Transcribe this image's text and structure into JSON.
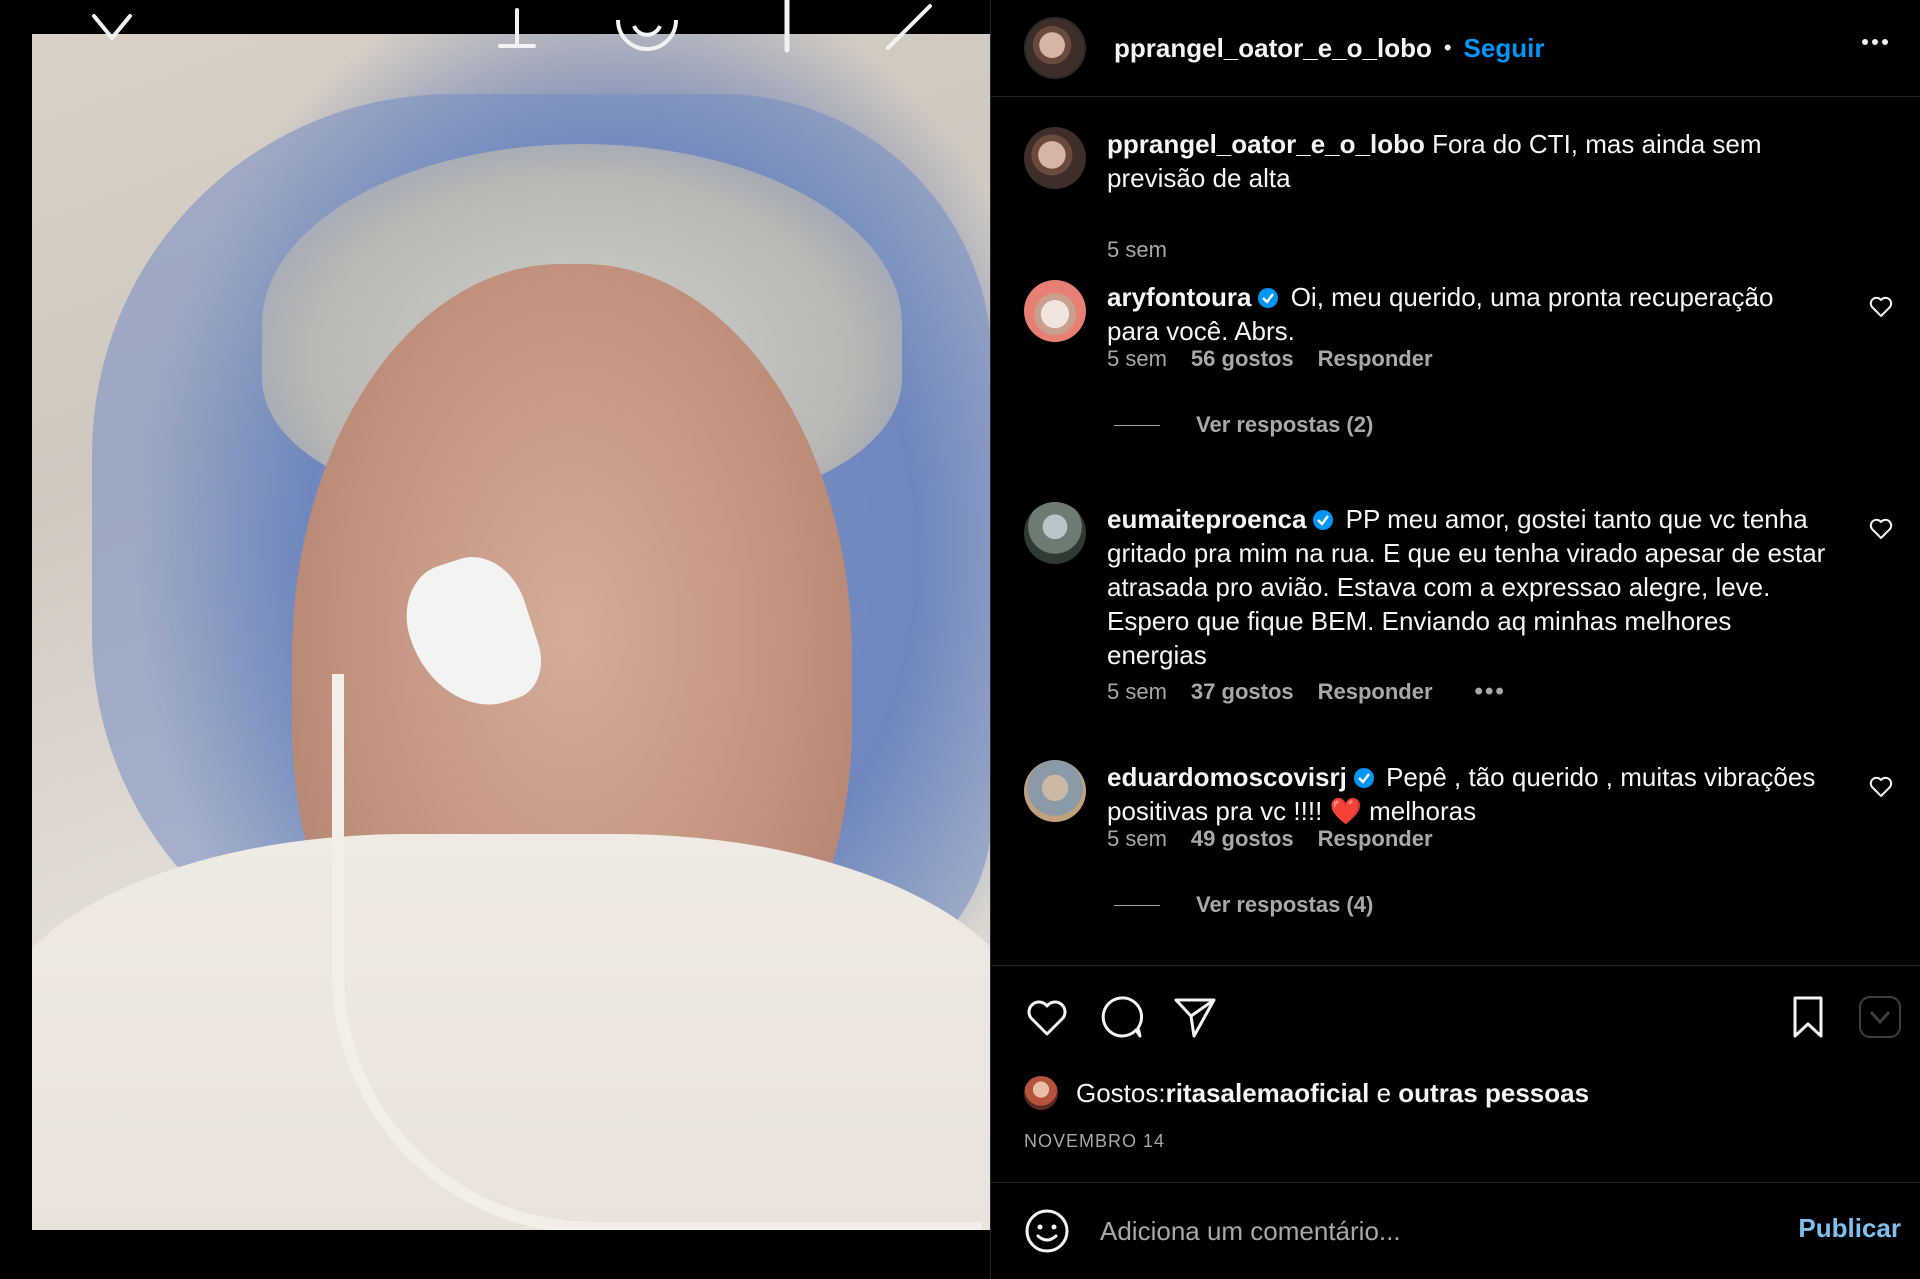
{
  "post": {
    "username": "pprangel_oator_e_o_lobo",
    "dot": "•",
    "follow_label": "Seguir",
    "caption": {
      "username": "pprangel_oator_e_o_lobo",
      "text": "Fora do CTI, mas ainda sem previsão de alta",
      "time": "5 sem"
    }
  },
  "comments": [
    {
      "username": "aryfontoura",
      "verified": true,
      "text": "Oi, meu querido, uma pronta recuperação para você. Abrs.",
      "time": "5 sem",
      "likes": "56 gostos",
      "reply_label": "Responder",
      "view_replies": "Ver respostas (2)"
    },
    {
      "username": "eumaiteproenca",
      "verified": true,
      "text": "PP meu amor, gostei tanto que vc tenha gritado pra mim na rua. E que eu tenha virado apesar de estar atrasada pro avião. Estava com a expressao alegre, leve. Espero que fique BEM. Enviando aq minhas melhores energias",
      "time": "5 sem",
      "likes": "37 gostos",
      "reply_label": "Responder",
      "more": "•••"
    },
    {
      "username": "eduardomoscovisrj",
      "verified": true,
      "text_before_heart": "Pepê , tão querido , muitas vibrações positivas pra vc !!!! ",
      "heart": "❤️",
      "text_after_heart": " melhoras",
      "time": "5 sem",
      "likes": "49 gostos",
      "reply_label": "Responder",
      "view_replies": "Ver respostas (4)"
    }
  ],
  "likes_row": {
    "prefix": "Gostos: ",
    "user": "ritasalemaoficial",
    "middle": " e ",
    "others": "outras pessoas"
  },
  "date": "NOVEMBRO 14",
  "add_comment": {
    "placeholder": "Adiciona um comentário...",
    "publish_label": "Publicar"
  },
  "icons": {
    "more": "more-icon",
    "like": "heart-icon",
    "comment": "comment-icon",
    "share": "share-icon",
    "save": "bookmark-icon",
    "emoji": "emoji-icon"
  },
  "colors": {
    "accent": "#0095f6",
    "background": "#000000",
    "text": "#f5f5f5",
    "secondary": "#a8a8a8",
    "verified": "#0095f6"
  }
}
